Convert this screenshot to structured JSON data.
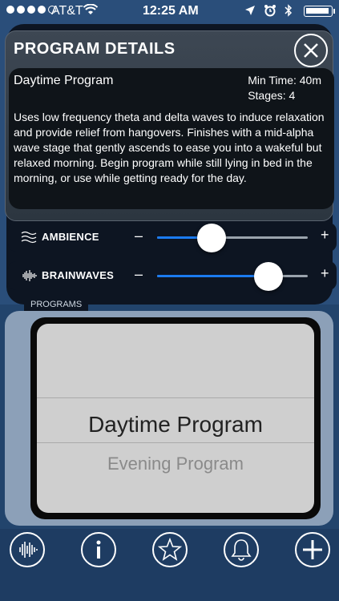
{
  "status_bar": {
    "carrier": "AT&T",
    "time": "12:25 AM"
  },
  "modal": {
    "title": "PROGRAM DETAILS",
    "program_name": "Daytime Program",
    "min_time": "Min Time: 40m",
    "stages": "Stages: 4",
    "description": "Uses low frequency theta and delta waves to induce relaxation and provide relief from hangovers.  Finishes with a mid-alpha wave stage that gently ascends to ease you into a wakeful but relaxed morning.  Begin program while still lying in bed in the morning, or use while getting ready for the day.",
    "close_icon": "close-icon"
  },
  "sliders": [
    {
      "label": "AMBIENCE",
      "minus": "–",
      "plus": "+",
      "value": 0.36,
      "icon": "waves-icon"
    },
    {
      "label": "BRAINWAVES",
      "minus": "–",
      "plus": "+",
      "value": 0.74,
      "icon": "soundwave-icon"
    }
  ],
  "programs": {
    "section_label": "PROGRAMS",
    "selected": "Daytime Program",
    "next": "Evening Program"
  },
  "toolbar": {
    "buttons": [
      "soundwave-icon",
      "info-icon",
      "star-icon",
      "bell-icon",
      "plus-icon"
    ]
  },
  "colors": {
    "accent": "#1b7bf0",
    "modal_bg": "#3d4753",
    "background": "#2a4e7a"
  }
}
